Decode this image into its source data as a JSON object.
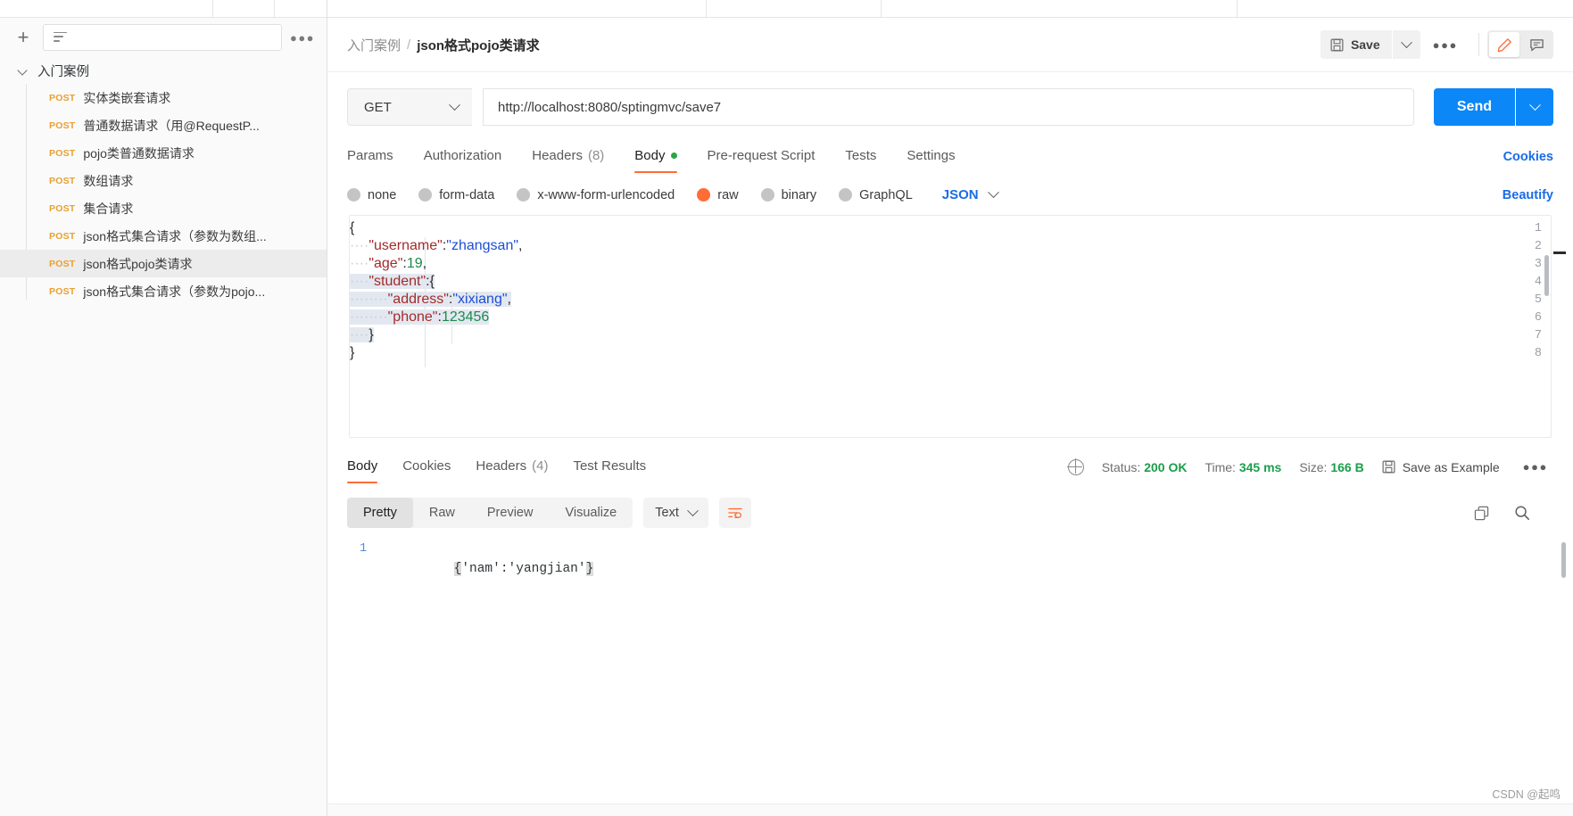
{
  "sidebar": {
    "add_label": "+",
    "filter_placeholder": "",
    "more_label": "●●●",
    "collection": {
      "name": "入门案例",
      "expanded": true
    },
    "requests": [
      {
        "method": "POST",
        "name": "实体类嵌套请求",
        "selected": false
      },
      {
        "method": "POST",
        "name": "普通数据请求（用@RequestP...",
        "selected": false
      },
      {
        "method": "POST",
        "name": "pojo类普通数据请求",
        "selected": false
      },
      {
        "method": "POST",
        "name": "数组请求",
        "selected": false
      },
      {
        "method": "POST",
        "name": "集合请求",
        "selected": false
      },
      {
        "method": "POST",
        "name": "json格式集合请求（参数为数组...",
        "selected": false
      },
      {
        "method": "POST",
        "name": "json格式pojo类请求",
        "selected": true
      },
      {
        "method": "POST",
        "name": "json格式集合请求（参数为pojo...",
        "selected": false
      }
    ]
  },
  "header": {
    "breadcrumb_parent": "入门案例",
    "breadcrumb_sep": "/",
    "breadcrumb_current": "json格式pojo类请求",
    "save_label": "Save",
    "more_label": "●●●"
  },
  "request": {
    "method": "GET",
    "url": "http://localhost:8080/sptingmvc/save7",
    "send_label": "Send",
    "tabs": [
      {
        "label": "Params",
        "active": false,
        "count": ""
      },
      {
        "label": "Authorization",
        "active": false,
        "count": ""
      },
      {
        "label": "Headers",
        "active": false,
        "count": "(8)"
      },
      {
        "label": "Body",
        "active": true,
        "count": ""
      },
      {
        "label": "Pre-request Script",
        "active": false,
        "count": ""
      },
      {
        "label": "Tests",
        "active": false,
        "count": ""
      },
      {
        "label": "Settings",
        "active": false,
        "count": ""
      }
    ],
    "cookies_link": "Cookies",
    "body_types": [
      {
        "label": "none",
        "selected": false
      },
      {
        "label": "form-data",
        "selected": false
      },
      {
        "label": "x-www-form-urlencoded",
        "selected": false
      },
      {
        "label": "raw",
        "selected": true
      },
      {
        "label": "binary",
        "selected": false
      },
      {
        "label": "GraphQL",
        "selected": false
      }
    ],
    "format": "JSON",
    "beautify_link": "Beautify",
    "body_lines": [
      {
        "no": "1",
        "segments": [
          {
            "t": "{",
            "c": "p"
          }
        ]
      },
      {
        "no": "2",
        "segments": [
          {
            "t": "····",
            "c": "ind"
          },
          {
            "t": "\"username\"",
            "c": "k"
          },
          {
            "t": ":",
            "c": "p"
          },
          {
            "t": "\"zhangsan\"",
            "c": "s"
          },
          {
            "t": ",",
            "c": "p"
          }
        ]
      },
      {
        "no": "3",
        "segments": [
          {
            "t": "····",
            "c": "ind"
          },
          {
            "t": "\"age\"",
            "c": "k"
          },
          {
            "t": ":",
            "c": "p"
          },
          {
            "t": "19",
            "c": "n"
          },
          {
            "t": ",",
            "c": "p"
          }
        ]
      },
      {
        "no": "4",
        "segments": [
          {
            "t": "····",
            "c": "ind"
          },
          {
            "t": "\"student\"",
            "c": "k"
          },
          {
            "t": ":",
            "c": "p"
          },
          {
            "t": "{",
            "c": "p"
          }
        ]
      },
      {
        "no": "5",
        "segments": [
          {
            "t": "········",
            "c": "ind"
          },
          {
            "t": "\"address\"",
            "c": "k"
          },
          {
            "t": ":",
            "c": "p"
          },
          {
            "t": "\"xixiang\"",
            "c": "s"
          },
          {
            "t": ",",
            "c": "p"
          }
        ]
      },
      {
        "no": "6",
        "segments": [
          {
            "t": "········",
            "c": "ind"
          },
          {
            "t": "\"phone\"",
            "c": "k"
          },
          {
            "t": ":",
            "c": "p"
          },
          {
            "t": "123456",
            "c": "n"
          }
        ]
      },
      {
        "no": "7",
        "segments": [
          {
            "t": "····",
            "c": "ind"
          },
          {
            "t": "}",
            "c": "p"
          }
        ]
      },
      {
        "no": "8",
        "segments": [
          {
            "t": "}",
            "c": "p"
          }
        ]
      }
    ]
  },
  "response": {
    "tabs": [
      {
        "label": "Body",
        "active": true,
        "count": ""
      },
      {
        "label": "Cookies",
        "active": false,
        "count": ""
      },
      {
        "label": "Headers",
        "active": false,
        "count": "(4)"
      },
      {
        "label": "Test Results",
        "active": false,
        "count": ""
      }
    ],
    "status_label": "Status:",
    "status_value": "200 OK",
    "time_label": "Time:",
    "time_value": "345 ms",
    "size_label": "Size:",
    "size_value": "166 B",
    "save_example_label": "Save as Example",
    "more_label": "●●●",
    "views": [
      {
        "label": "Pretty",
        "active": true
      },
      {
        "label": "Raw",
        "active": false
      },
      {
        "label": "Preview",
        "active": false
      },
      {
        "label": "Visualize",
        "active": false
      }
    ],
    "format": "Text",
    "body_line_no": "1",
    "body_text": "{'nam':'yangjian'}"
  },
  "watermark": "CSDN @起鸣",
  "colors": {
    "accent_orange": "#ff6c37",
    "send_blue": "#0c87f7",
    "link_blue": "#1a6ce7",
    "post_orange": "#e8a033",
    "status_green": "#1b9e4b"
  }
}
